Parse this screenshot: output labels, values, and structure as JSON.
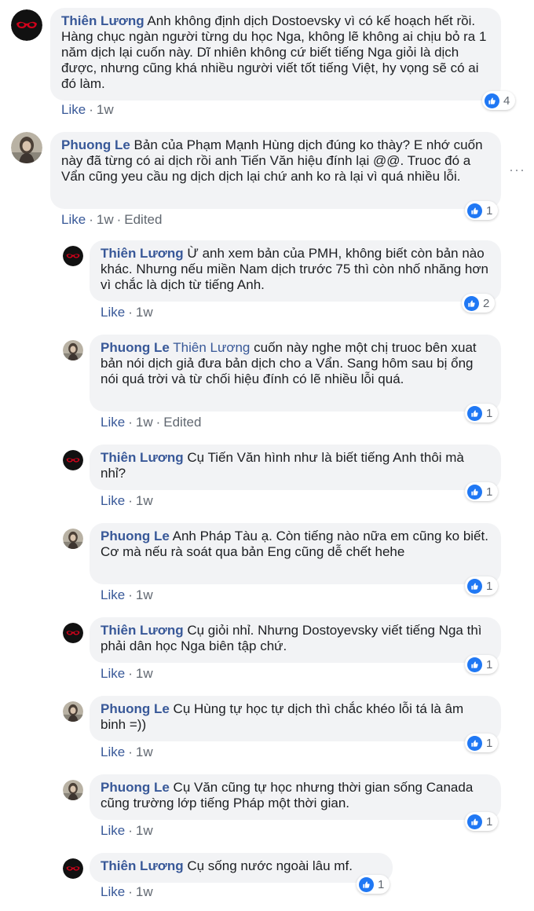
{
  "comments": [
    {
      "author": "Thiên Lương",
      "text": " Anh không định dịch Dostoevsky vì có kế hoạch hết rồi. Hàng chục ngàn người từng du học Nga, không lẽ không ai chịu bỏ ra 1 năm dịch lại cuốn này. Dĩ nhiên không cứ biết tiếng Nga giỏi là dịch được, nhưng cũng khá nhiều người viết tốt tiếng Việt, hy vọng sẽ có ai đó làm.",
      "like_label": "Like",
      "sep": "·",
      "time": "1w",
      "reactions": "4"
    },
    {
      "author": "Phuong Le",
      "text": " Bản của Phạm Mạnh Hùng dịch đúng ko thày? E nhớ cuốn này đã từng có ai dịch rồi anh Tiến Văn hiệu đính lại @@. Truoc đó a Vẩn cũng yeu cầu ng dịch dịch lại chứ anh ko rà lại vì quá nhiều lỗi.",
      "like_label": "Like",
      "sep": "·",
      "time": "1w",
      "edited": "Edited",
      "reactions": "1",
      "more": "···"
    },
    {
      "author": "Thiên Lương",
      "text": " Ừ anh xem bản của PMH, không biết còn bản nào khác. Nhưng nếu miền Nam dịch trước 75 thì còn nhố nhăng hơn vì chắc là dịch từ tiếng Anh.",
      "like_label": "Like",
      "sep": "·",
      "time": "1w",
      "reactions": "2"
    },
    {
      "author": "Phuong Le",
      "tag": "Thiên Lương",
      "text": " cuốn này nghe một chị truoc bên xuat bản nói dịch giả đưa bản dịch cho a Vẩn. Sang hôm sau bị ổng nói quá trời và từ chối hiệu đính có lẽ nhiều lỗi quá.",
      "like_label": "Like",
      "sep": "·",
      "time": "1w",
      "edited": "Edited",
      "reactions": "1"
    },
    {
      "author": "Thiên Lương",
      "text": " Cụ Tiến Văn hình như là biết tiếng Anh thôi mà nhỉ?",
      "like_label": "Like",
      "sep": "·",
      "time": "1w",
      "reactions": "1"
    },
    {
      "author": "Phuong Le",
      "text": " Anh Pháp Tàu ạ. Còn tiếng nào nữa em cũng ko biết. Cơ mà nếu rà soát qua bản Eng cũng dễ chết hehe",
      "like_label": "Like",
      "sep": "·",
      "time": "1w",
      "reactions": "1"
    },
    {
      "author": "Thiên Lương",
      "text": " Cụ giỏi nhỉ. Nhưng Dostoyevsky viết tiếng Nga thì phải dân học Nga biên tập chứ.",
      "like_label": "Like",
      "sep": "·",
      "time": "1w",
      "reactions": "1"
    },
    {
      "author": "Phuong Le",
      "text": " Cụ Hùng tự học tự dịch thì chắc khéo lỗi tá là âm binh =))",
      "like_label": "Like",
      "sep": "·",
      "time": "1w",
      "reactions": "1"
    },
    {
      "author": "Phuong Le",
      "text": " Cụ Văn cũng tự học nhưng thời gian sống Canada cũng trường lớp tiếng Pháp một thời gian.",
      "like_label": "Like",
      "sep": "·",
      "time": "1w",
      "reactions": "1"
    },
    {
      "author": "Thiên Lương",
      "text": " Cụ sống nước ngoài lâu mf.",
      "like_label": "Like",
      "sep": "·",
      "time": "1w",
      "reactions": "1"
    }
  ],
  "icons": {
    "like_reaction": "thumbs-up-icon",
    "avatar_thien_luong": "red-glasses-avatar",
    "avatar_phuong_le": "photo-avatar"
  },
  "colors": {
    "name": "#385898",
    "bubble": "#f2f3f5",
    "like_badge": "#2078f4",
    "meta": "#606770"
  }
}
